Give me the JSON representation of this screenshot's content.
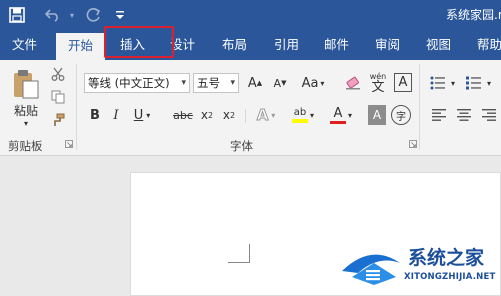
{
  "window": {
    "title": "系统家园.r"
  },
  "quick_access": {
    "save_icon": "save-icon",
    "undo_icon": "undo-icon",
    "redo_icon": "redo-icon",
    "customize_icon": "customize-icon"
  },
  "tabs": [
    {
      "label": "文件"
    },
    {
      "label": "开始"
    },
    {
      "label": "插入"
    },
    {
      "label": "设计"
    },
    {
      "label": "布局"
    },
    {
      "label": "引用"
    },
    {
      "label": "邮件"
    },
    {
      "label": "审阅"
    },
    {
      "label": "视图"
    },
    {
      "label": "帮助"
    }
  ],
  "active_tab": "开始",
  "highlighted_tab": "插入",
  "clipboard": {
    "paste_label": "粘贴",
    "group_label": "剪贴板"
  },
  "font": {
    "family_value": "等线 (中文正文)",
    "size_value": "五号",
    "group_label": "字体",
    "grow_label": "A",
    "shrink_label": "A",
    "case_label": "Aa",
    "phonetic_label": "wén",
    "phonetic_char": "文",
    "border_char": "A",
    "bold": "B",
    "italic": "I",
    "underline": "U",
    "strike": "abc",
    "subscript": "x",
    "superscript": "x",
    "sub_digit": "2",
    "sup_digit": "2",
    "effects": "A",
    "highlight_text": "ab",
    "color_text": "A",
    "shading_char": "A",
    "enclose_char": "字"
  },
  "colors": {
    "accent": "#2b579a",
    "highlight_box": "#d9212f",
    "highlight_yellow": "#ffff00",
    "font_red": "#e02020"
  },
  "watermark": {
    "title": "系统之家",
    "subtitle": "XITONGZHIJIA.NET"
  }
}
